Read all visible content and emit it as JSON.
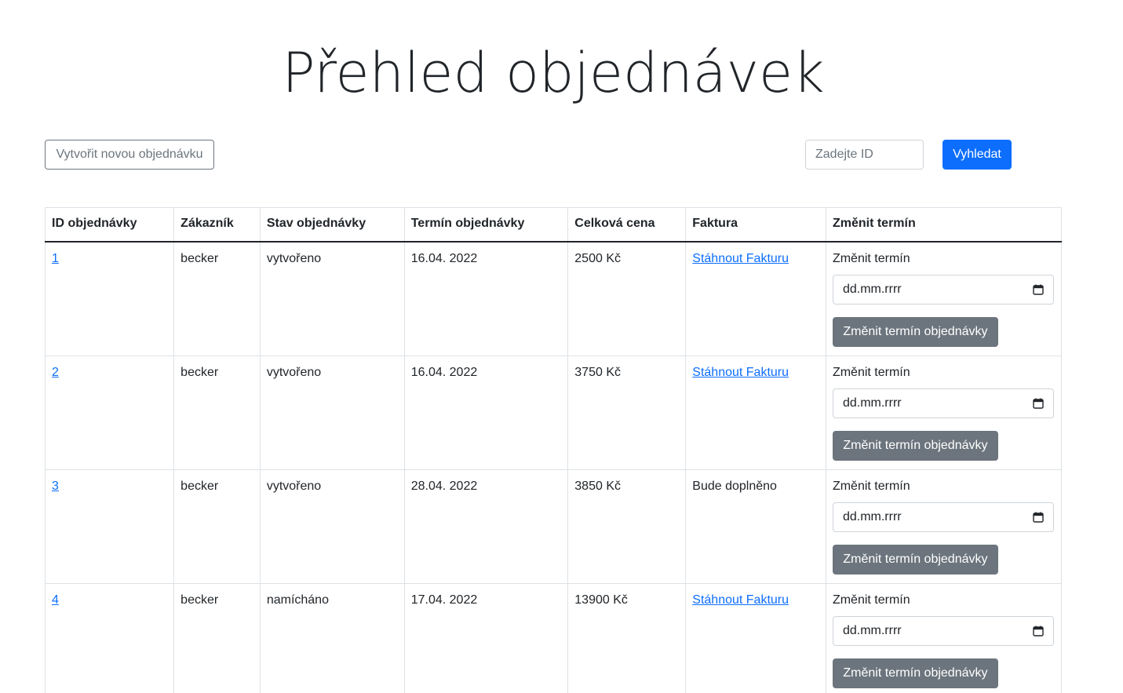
{
  "title": "Přehled objednávek",
  "toolbar": {
    "create_label": "Vytvořit novou objednávku",
    "search_placeholder": "Zadejte ID",
    "search_label": "Vyhledat"
  },
  "table": {
    "headers": [
      "ID objednávky",
      "Zákazník",
      "Stav objednávky",
      "Termín objednávky",
      "Celková cena",
      "Faktura",
      "Změnit termín"
    ],
    "rows": [
      {
        "id": "1",
        "customer": "becker",
        "state": "vytvořeno",
        "date": "16.04. 2022",
        "price": "2500 Kč",
        "invoice": "Stáhnout Fakturu",
        "invoice_is_link": true,
        "change_label": "Změnit termín",
        "date_placeholder": "dd.mm.rrrr",
        "change_button": "Změnit termín objednávky"
      },
      {
        "id": "2",
        "customer": "becker",
        "state": "vytvořeno",
        "date": "16.04. 2022",
        "price": "3750 Kč",
        "invoice": "Stáhnout Fakturu",
        "invoice_is_link": true,
        "change_label": "Změnit termín",
        "date_placeholder": "dd.mm.rrrr",
        "change_button": "Změnit termín objednávky"
      },
      {
        "id": "3",
        "customer": "becker",
        "state": "vytvořeno",
        "date": "28.04. 2022",
        "price": "3850 Kč",
        "invoice": "Bude doplněno",
        "invoice_is_link": false,
        "change_label": "Změnit termín",
        "date_placeholder": "dd.mm.rrrr",
        "change_button": "Změnit termín objednávky"
      },
      {
        "id": "4",
        "customer": "becker",
        "state": "namícháno",
        "date": "17.04. 2022",
        "price": "13900 Kč",
        "invoice": "Stáhnout Fakturu",
        "invoice_is_link": true,
        "change_label": "Změnit termín",
        "date_placeholder": "dd.mm.rrrr",
        "change_button": "Změnit termín objednávky"
      }
    ]
  },
  "colors": {
    "primary": "#0d6efd",
    "secondary": "#6c757d",
    "text": "#212529",
    "border": "#dee2e6"
  },
  "icons": {
    "date_picker": "calendar-icon"
  }
}
